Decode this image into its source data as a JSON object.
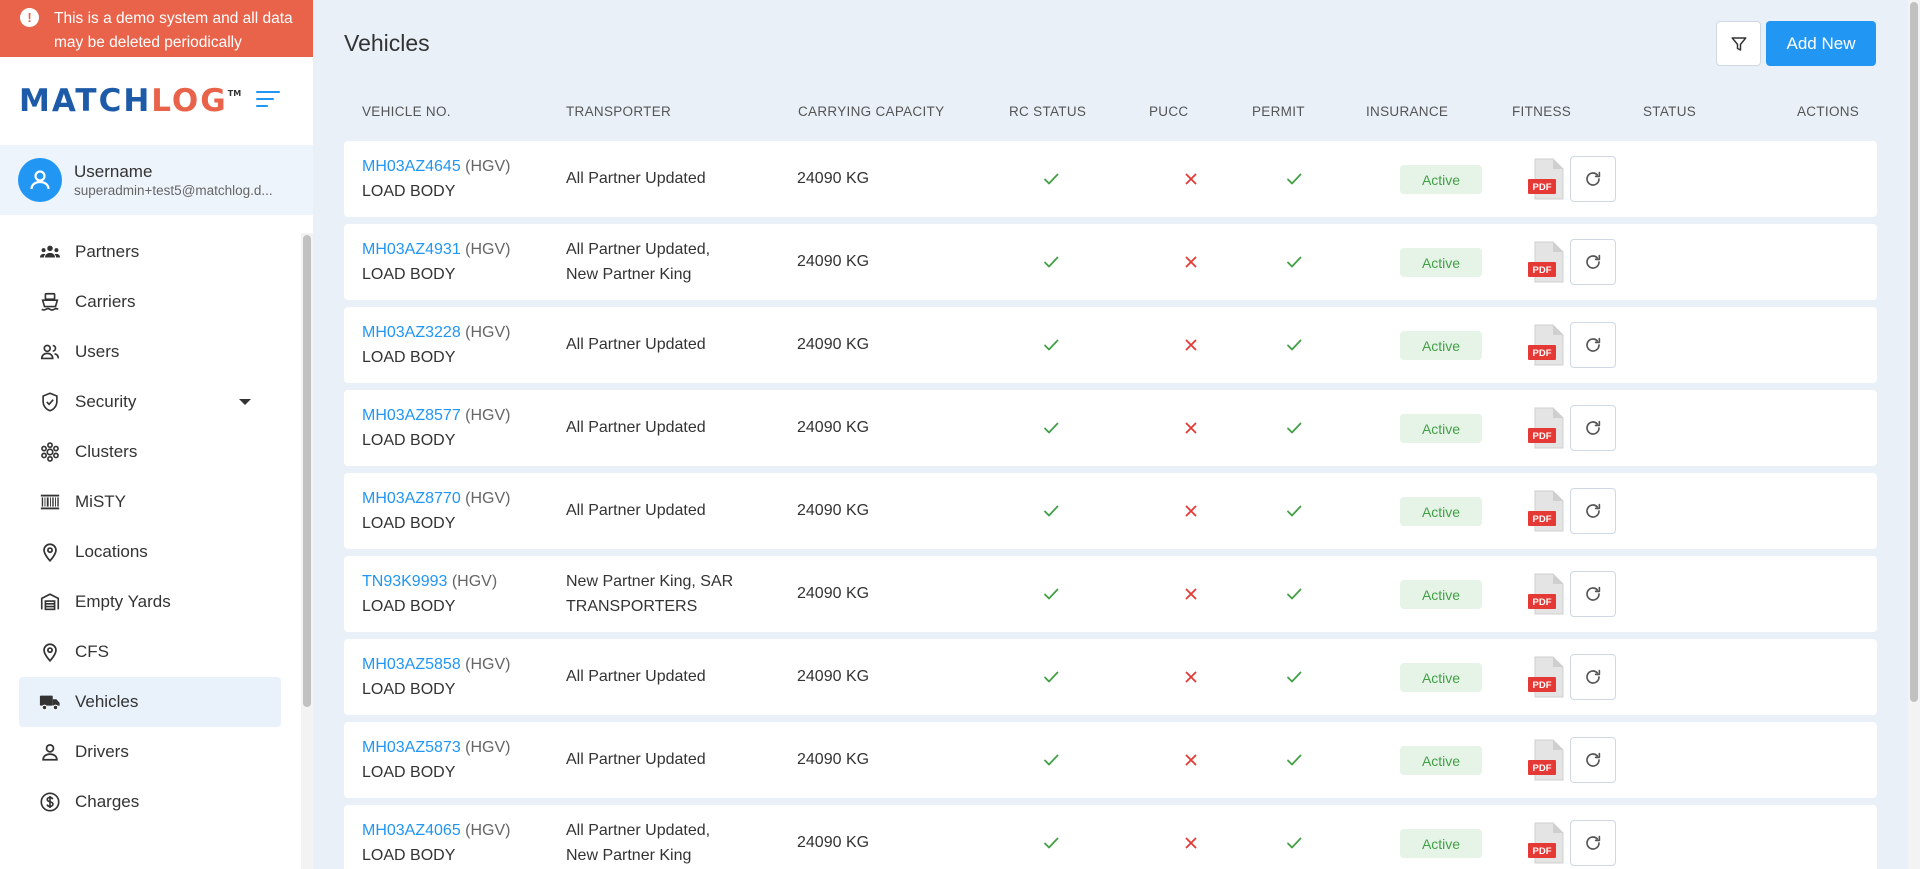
{
  "banner": {
    "text": "This is a demo system and all data may be deleted periodically"
  },
  "brand": {
    "logo_a": "MATCH",
    "logo_b": "LOG",
    "tm": "TM"
  },
  "user": {
    "name": "Username",
    "email": "superadmin+test5@matchlog.d..."
  },
  "sidebar": {
    "items": [
      {
        "label": "Partners",
        "icon": "partners-icon"
      },
      {
        "label": "Carriers",
        "icon": "ship-icon"
      },
      {
        "label": "Users",
        "icon": "users-icon"
      },
      {
        "label": "Security",
        "icon": "shield-icon"
      },
      {
        "label": "Clusters",
        "icon": "clusters-icon"
      },
      {
        "label": "MiSTY",
        "icon": "barcode-icon"
      },
      {
        "label": "Locations",
        "icon": "location-pin-icon"
      },
      {
        "label": "Empty Yards",
        "icon": "warehouse-icon"
      },
      {
        "label": "CFS",
        "icon": "location-pin-icon"
      },
      {
        "label": "Vehicles",
        "icon": "truck-icon"
      },
      {
        "label": "Drivers",
        "icon": "person-icon"
      },
      {
        "label": "Charges",
        "icon": "dollar-icon"
      }
    ],
    "active": "Vehicles"
  },
  "page": {
    "title": "Vehicles",
    "add_label": "Add New"
  },
  "table": {
    "headers": {
      "vehicle": "VEHICLE NO.",
      "transporter": "TRANSPORTER",
      "capacity": "CARRYING CAPACITY",
      "rc": "RC STATUS",
      "pucc": "PUCC",
      "permit": "PERMIT",
      "insurance": "INSURANCE",
      "fitness": "FITNESS",
      "status": "STATUS",
      "actions": "ACTIONS"
    },
    "rows": [
      {
        "no": "MH03AZ4645",
        "type": "(HGV)",
        "body": "LOAD BODY",
        "t1": "All Partner Updated",
        "t2": "",
        "capacity": "24090 KG",
        "rc": true,
        "pucc": false,
        "permit": true,
        "insurance": false,
        "fitness": true,
        "status": "Active"
      },
      {
        "no": "MH03AZ4931",
        "type": "(HGV)",
        "body": "LOAD BODY",
        "t1": "All Partner Updated,",
        "t2": "New Partner King",
        "capacity": "24090 KG",
        "rc": true,
        "pucc": false,
        "permit": true,
        "insurance": false,
        "fitness": true,
        "status": "Active"
      },
      {
        "no": "MH03AZ3228",
        "type": "(HGV)",
        "body": "LOAD BODY",
        "t1": "All Partner Updated",
        "t2": "",
        "capacity": "24090 KG",
        "rc": true,
        "pucc": false,
        "permit": true,
        "insurance": false,
        "fitness": true,
        "status": "Active"
      },
      {
        "no": "MH03AZ8577",
        "type": "(HGV)",
        "body": "LOAD BODY",
        "t1": "All Partner Updated",
        "t2": "",
        "capacity": "24090 KG",
        "rc": true,
        "pucc": false,
        "permit": true,
        "insurance": false,
        "fitness": true,
        "status": "Active"
      },
      {
        "no": "MH03AZ8770",
        "type": "(HGV)",
        "body": "LOAD BODY",
        "t1": "All Partner Updated",
        "t2": "",
        "capacity": "24090 KG",
        "rc": true,
        "pucc": false,
        "permit": true,
        "insurance": false,
        "fitness": true,
        "status": "Active"
      },
      {
        "no": "TN93K9993",
        "type": "(HGV)",
        "body": "LOAD BODY",
        "t1": "New Partner King, SAR",
        "t2": "TRANSPORTERS",
        "capacity": "24090 KG",
        "rc": true,
        "pucc": false,
        "permit": true,
        "insurance": false,
        "fitness": true,
        "status": "Active"
      },
      {
        "no": "MH03AZ5858",
        "type": "(HGV)",
        "body": "LOAD BODY",
        "t1": "All Partner Updated",
        "t2": "",
        "capacity": "24090 KG",
        "rc": true,
        "pucc": false,
        "permit": true,
        "insurance": false,
        "fitness": true,
        "status": "Active"
      },
      {
        "no": "MH03AZ5873",
        "type": "(HGV)",
        "body": "LOAD BODY",
        "t1": "All Partner Updated",
        "t2": "",
        "capacity": "24090 KG",
        "rc": true,
        "pucc": false,
        "permit": true,
        "insurance": false,
        "fitness": true,
        "status": "Active"
      },
      {
        "no": "MH03AZ4065",
        "type": "(HGV)",
        "body": "LOAD BODY",
        "t1": "All Partner Updated,",
        "t2": "New Partner King",
        "capacity": "24090 KG",
        "rc": true,
        "pucc": false,
        "permit": true,
        "insurance": false,
        "fitness": true,
        "status": "Active"
      }
    ],
    "pdf_label": "PDF"
  },
  "colors": {
    "accent": "#2196f3",
    "banner": "#e9634b",
    "check": "#43a047",
    "cross": "#e53935"
  }
}
